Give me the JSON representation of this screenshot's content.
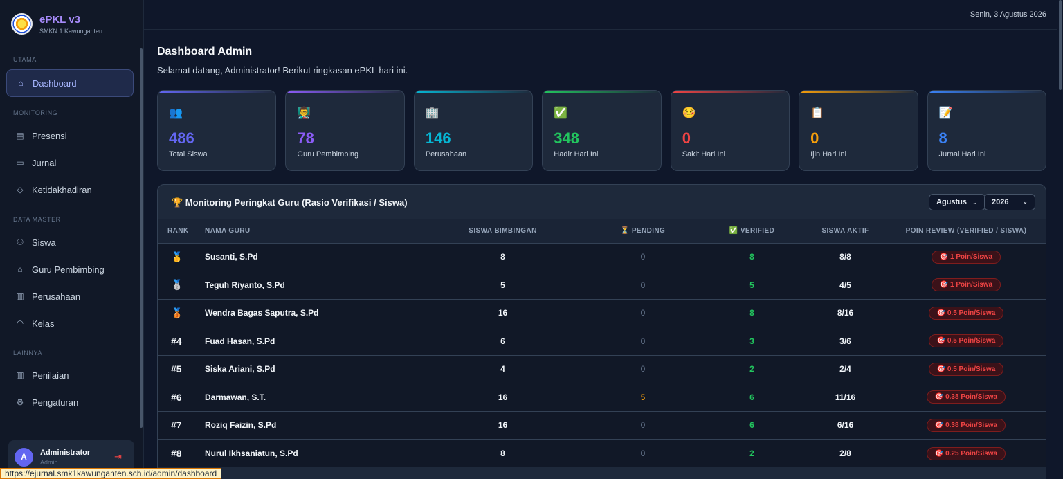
{
  "brand": {
    "title": "ePKL v3",
    "school": "SMKN 1 Kawunganten"
  },
  "nav": {
    "sections": {
      "utama": "UTAMA",
      "monitoring": "MONITORING",
      "data_master": "DATA MASTER",
      "lainnya": "LAINNYA"
    },
    "items": {
      "dashboard": "Dashboard",
      "presensi": "Presensi",
      "jurnal": "Jurnal",
      "ketidakhadiran": "Ketidakhadiran",
      "siswa": "Siswa",
      "guru": "Guru Pembimbing",
      "perusahaan": "Perusahaan",
      "kelas": "Kelas",
      "penilaian": "Penilaian",
      "pengaturan": "Pengaturan"
    }
  },
  "user": {
    "initial": "A",
    "name": "Administrator",
    "role": "Admin"
  },
  "status_url": "https://ejurnal.smk1kawunganten.sch.id/admin/dashboard",
  "topbar": {
    "date": "Senin, 3 Agustus 2026"
  },
  "header": {
    "title": "Dashboard Admin",
    "subtitle": "Selamat datang, Administrator! Berikut ringkasan ePKL hari ini."
  },
  "cards": [
    {
      "icon": "👥",
      "value": "486",
      "label": "Total Siswa",
      "color": "#6366f1"
    },
    {
      "icon": "👨‍🏫",
      "value": "78",
      "label": "Guru Pembimbing",
      "color": "#8b5cf6"
    },
    {
      "icon": "🏢",
      "value": "146",
      "label": "Perusahaan",
      "color": "#06b6d4"
    },
    {
      "icon": "✅",
      "value": "348",
      "label": "Hadir Hari Ini",
      "color": "#22c55e"
    },
    {
      "icon": "🤒",
      "value": "0",
      "label": "Sakit Hari Ini",
      "color": "#ef4444"
    },
    {
      "icon": "📋",
      "value": "0",
      "label": "Ijin Hari Ini",
      "color": "#f59e0b"
    },
    {
      "icon": "📝",
      "value": "8",
      "label": "Jurnal Hari Ini",
      "color": "#3b82f6"
    }
  ],
  "ranking": {
    "title": "🏆 Monitoring Peringkat Guru (Rasio Verifikasi / Siswa)",
    "month": "Agustus",
    "year": "2026",
    "columns": [
      "RANK",
      "NAMA GURU",
      "SISWA BIMBINGAN",
      "⏳ PENDING",
      "✅ VERIFIED",
      "SISWA AKTIF",
      "POIN REVIEW (VERIFIED / SISWA)"
    ],
    "rows": [
      {
        "rank": "🥇",
        "name": "Susanti, S.Pd",
        "siswa": "8",
        "pending": "0",
        "verified": "8",
        "aktif": "8/8",
        "poin": "🎯 1 Poin/Siswa"
      },
      {
        "rank": "🥈",
        "name": "Teguh Riyanto, S.Pd",
        "siswa": "5",
        "pending": "0",
        "verified": "5",
        "aktif": "4/5",
        "poin": "🎯 1 Poin/Siswa"
      },
      {
        "rank": "🥉",
        "name": "Wendra Bagas Saputra, S.Pd",
        "siswa": "16",
        "pending": "0",
        "verified": "8",
        "aktif": "8/16",
        "poin": "🎯 0.5 Poin/Siswa"
      },
      {
        "rank": "#4",
        "name": "Fuad Hasan, S.Pd",
        "siswa": "6",
        "pending": "0",
        "verified": "3",
        "aktif": "3/6",
        "poin": "🎯 0.5 Poin/Siswa"
      },
      {
        "rank": "#5",
        "name": "Siska Ariani, S.Pd",
        "siswa": "4",
        "pending": "0",
        "verified": "2",
        "aktif": "2/4",
        "poin": "🎯 0.5 Poin/Siswa"
      },
      {
        "rank": "#6",
        "name": "Darmawan, S.T.",
        "siswa": "16",
        "pending": "5",
        "verified": "6",
        "aktif": "11/16",
        "poin": "🎯 0.38 Poin/Siswa"
      },
      {
        "rank": "#7",
        "name": "Roziq Faizin, S.Pd",
        "siswa": "16",
        "pending": "0",
        "verified": "6",
        "aktif": "6/16",
        "poin": "🎯 0.38 Poin/Siswa"
      },
      {
        "rank": "#8",
        "name": "Nurul Ikhsaniatun, S.Pd",
        "siswa": "8",
        "pending": "0",
        "verified": "2",
        "aktif": "2/8",
        "poin": "🎯 0.25 Poin/Siswa"
      }
    ]
  }
}
